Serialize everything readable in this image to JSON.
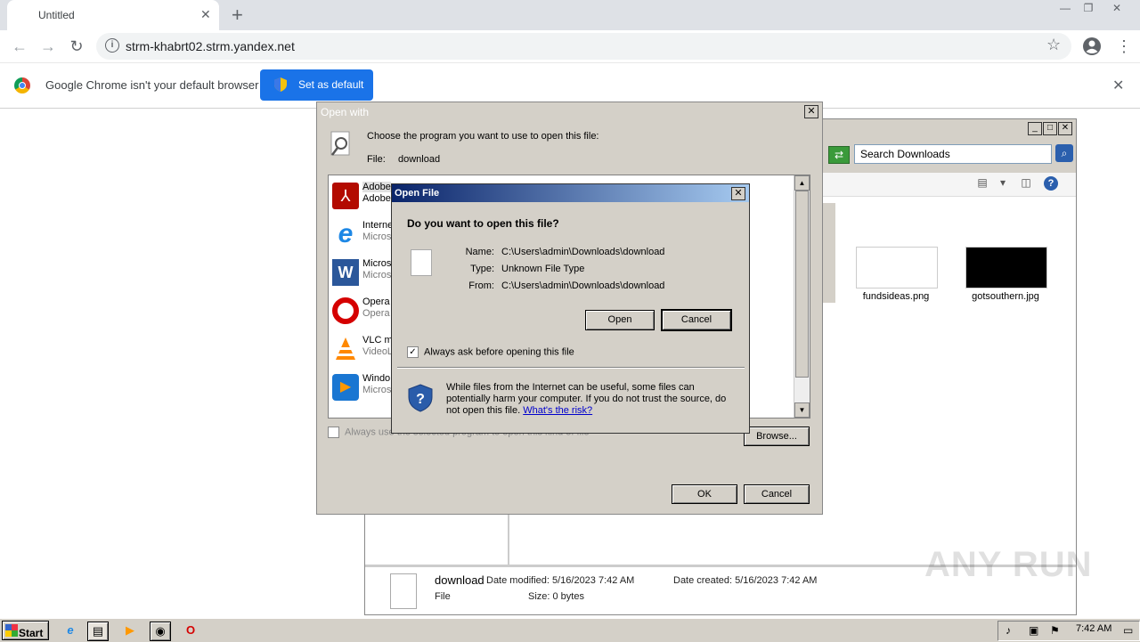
{
  "browser": {
    "tab_title": "Untitled",
    "tab_close": "✕",
    "new_tab": "+",
    "url": "strm-khabrt02.strm.yandex.net",
    "window_controls": {
      "minimize": "—",
      "restore": "❐",
      "close": "✕"
    },
    "nav": {
      "back": "←",
      "forward": "→",
      "reload": "↻"
    },
    "star": "☆",
    "menu": "⋮"
  },
  "infobar": {
    "message": "Google Chrome isn't your default browser",
    "button": "Set as default",
    "close": "✕"
  },
  "explorer": {
    "search_placeholder": "Search Downloads",
    "files": [
      {
        "name": "fundsideas.png"
      },
      {
        "name": "gotsouthern.jpg"
      }
    ],
    "details": {
      "name": "download",
      "type": "File",
      "modified": "Date modified: 5/16/2023 7:42 AM",
      "created": "Date created: 5/16/2023 7:42 AM",
      "size": "Size: 0 bytes"
    }
  },
  "openwith": {
    "title": "Open with",
    "choose": "Choose the program you want to use to open this file:",
    "file_label": "File:",
    "file_value": "download",
    "programs": [
      {
        "name": "Adobe",
        "company": "Adobe",
        "icon": "adobe-pdf-icon"
      },
      {
        "name": "Interne",
        "company": "Micros",
        "icon": "internet-explorer-icon"
      },
      {
        "name": "Micros",
        "company": "Micros",
        "icon": "word-icon"
      },
      {
        "name": "Opera",
        "company": "Opera",
        "icon": "opera-icon"
      },
      {
        "name": "VLC me",
        "company": "VideoL",
        "icon": "vlc-icon"
      },
      {
        "name": "Windo",
        "company": "Micros",
        "icon": "media-player-icon"
      }
    ],
    "always_use": "Always use the selected program to open this kind of file",
    "browse": "Browse...",
    "ok": "OK",
    "cancel": "Cancel"
  },
  "openfile": {
    "title": "Open File",
    "question": "Do you want to open this file?",
    "name_label": "Name:",
    "name_value": "C:\\Users\\admin\\Downloads\\download",
    "type_label": "Type:",
    "type_value": "Unknown File Type",
    "from_label": "From:",
    "from_value": "C:\\Users\\admin\\Downloads\\download",
    "open": "Open",
    "cancel": "Cancel",
    "always_ask": "Always ask before opening this file",
    "warning": "While files from the Internet can be useful, some files can potentially harm your computer. If you do not trust the source, do not open this file.",
    "risk_link": "What's the risk?"
  },
  "taskbar": {
    "start": "Start",
    "clock": "7:42 AM"
  },
  "watermark": "ANY RUN",
  "colors": {
    "chrome_blue": "#1a73e8",
    "dialog_gray": "#d4d0c8",
    "title_blue": "#0a246a"
  }
}
